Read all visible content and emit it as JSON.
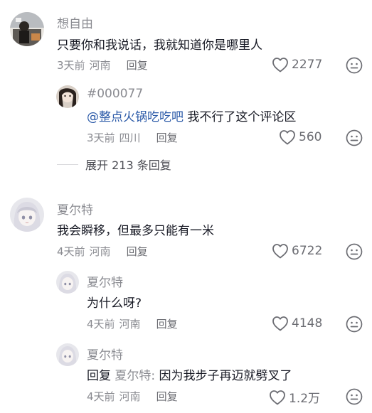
{
  "comments": [
    {
      "username": "想自由",
      "text": "只要你和我说话，我就知道你是哪里人",
      "time": "3天前",
      "location": "河南",
      "reply_label": "回复",
      "likes": "2277",
      "replies": [
        {
          "username": "#000077",
          "mention": "@整点火锅吃吃吧",
          "text": "我不行了这个评论区",
          "time": "3天前",
          "location": "四川",
          "reply_label": "回复",
          "likes": "560"
        }
      ],
      "expand_label": "展开 213 条回复"
    },
    {
      "username": "夏尔特",
      "text": "我会瞬移，但最多只能有一米",
      "time": "4天前",
      "location": "河南",
      "reply_label": "回复",
      "likes": "6722",
      "replies": [
        {
          "username": "夏尔特",
          "text": "为什么呀?",
          "time": "4天前",
          "location": "河南",
          "reply_label": "回复",
          "likes": "4148"
        },
        {
          "username": "夏尔特",
          "reply_prefix": "回复",
          "reply_to": "夏尔特:",
          "text": "因为我步子再迈就劈叉了",
          "time": "4天前",
          "location": "河南",
          "reply_label": "回复",
          "likes": "1.2万"
        }
      ]
    }
  ],
  "icons": {
    "like": "heart-outline-icon",
    "dislike": "meh-face-icon"
  },
  "colors": {
    "text": "#161823",
    "secondary": "#8a8b91",
    "mention": "#2b5aa8"
  }
}
